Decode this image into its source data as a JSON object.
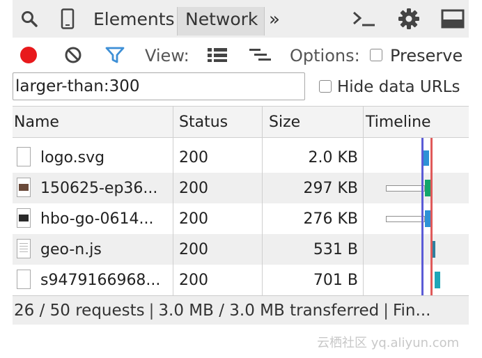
{
  "tabs": {
    "elements": "Elements",
    "network": "Network",
    "overflow": "»"
  },
  "toolbar": {
    "view_label": "View:",
    "options_label": "Options:",
    "preserve_label": "Preserve",
    "record_color": "#e8191c",
    "filter_color": "#3d8fd6"
  },
  "filter": {
    "value": "larger-than:300",
    "hide_data_urls_label": "Hide data URLs"
  },
  "table": {
    "columns": [
      "Name",
      "Status",
      "Size",
      "Timeline"
    ],
    "rows": [
      {
        "name": "logo.svg",
        "status": "200",
        "size": "2.0 KB",
        "icon": "file-icon"
      },
      {
        "name": "150625-ep36...",
        "status": "200",
        "size": "297 KB",
        "icon": "image-thumbnail-icon"
      },
      {
        "name": "hbo-go-0614...",
        "status": "200",
        "size": "276 KB",
        "icon": "image-thumbnail-icon"
      },
      {
        "name": "geo-n.js",
        "status": "200",
        "size": "531 B",
        "icon": "script-file-icon"
      },
      {
        "name": "s9479166968...",
        "status": "200",
        "size": "701 B",
        "icon": "file-icon"
      }
    ],
    "timeline_colors": {
      "image": "#2e91d6",
      "image_tail": "#14a56c",
      "script": "#2f7f9e",
      "other": "#1fa6b8",
      "dom_content_loaded": "#5b5bd6",
      "load": "#e05a5a"
    }
  },
  "statusbar": {
    "requests": "26 / 50 requests",
    "size": "3.0 MB / 3.0 MB transferred",
    "finish": "Fin..."
  },
  "watermark": "云栖社区 yq.aliyun.com"
}
